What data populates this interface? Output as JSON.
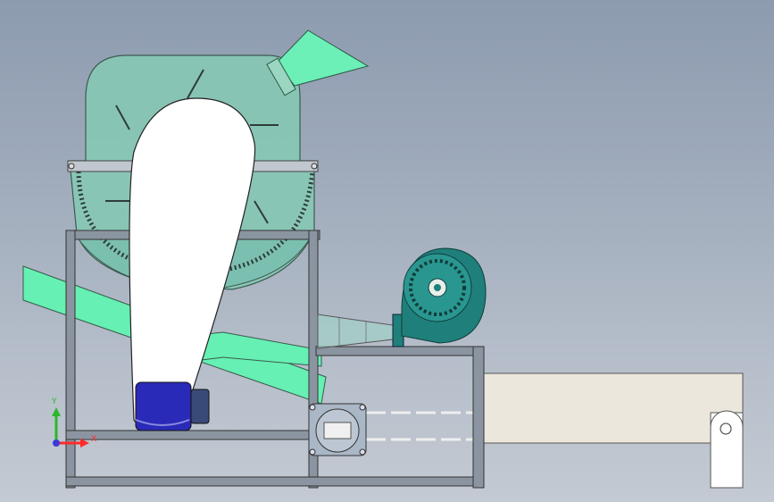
{
  "viewport": {
    "background_top": "#8d9bb0",
    "background_bottom": "#c4cad3"
  },
  "triad": {
    "x_label": "X",
    "y_label": "Y",
    "x_color": "#ff2a2a",
    "y_color": "#2ab82a",
    "z_color": "#3a3ad8"
  },
  "colors": {
    "hopper": "#7cc8b4",
    "chute": "#66f0b4",
    "belt_cover": "#ffffff",
    "frame": "#7f8a96",
    "motor": "#2a2ab8",
    "blower": "#1f7f7a",
    "conveyor": "#ece7dc"
  },
  "components": [
    "crusher-housing",
    "feed-hopper",
    "belt-guard",
    "discharge-chute",
    "support-frame",
    "drive-motor",
    "blower-fan",
    "air-duct",
    "control-box",
    "conveyor-belt"
  ]
}
